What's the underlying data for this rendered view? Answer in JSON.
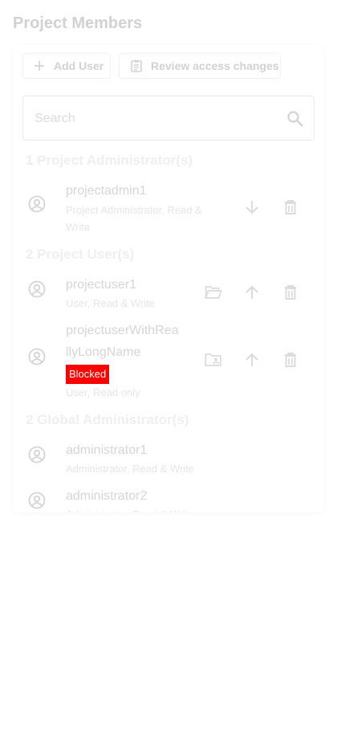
{
  "page": {
    "title": "Project Members"
  },
  "toolbar": {
    "add_user_label": "Add User",
    "review_label": "Review access changes"
  },
  "search": {
    "placeholder": "Search",
    "value": ""
  },
  "sections": [
    {
      "title": "1 Project Administrator(s)",
      "members": [
        {
          "name": "projectadmin1",
          "role_line1": "Project Administrator, Read &",
          "role_line2": "Write"
        }
      ]
    },
    {
      "title": "2 Project User(s)",
      "members": [
        {
          "name": "projectuser1",
          "role": "User, Read & Write"
        },
        {
          "name_line1": "projectuserWithRea",
          "name_line2": "llyLongName",
          "badge": "Blocked",
          "role": "User, Read only"
        }
      ]
    },
    {
      "title": "2 Global Administrator(s)",
      "members": [
        {
          "name": "administrator1",
          "role": "Administrator, Read & Write"
        },
        {
          "name": "administrator2",
          "role": "Administrator, Read & Write"
        }
      ]
    }
  ],
  "icons": {
    "add": "plus-icon",
    "review": "clipboard-icon",
    "search": "search-icon",
    "avatar": "account-circle-icon",
    "demote": "arrow-down-icon",
    "promote": "arrow-up-icon",
    "delete": "trash-icon",
    "folder": "folder-open-icon",
    "folder_user": "folder-account-icon"
  },
  "colors": {
    "blocked_badge": "#ff0000",
    "disabled_text": "#d2d2d2"
  }
}
